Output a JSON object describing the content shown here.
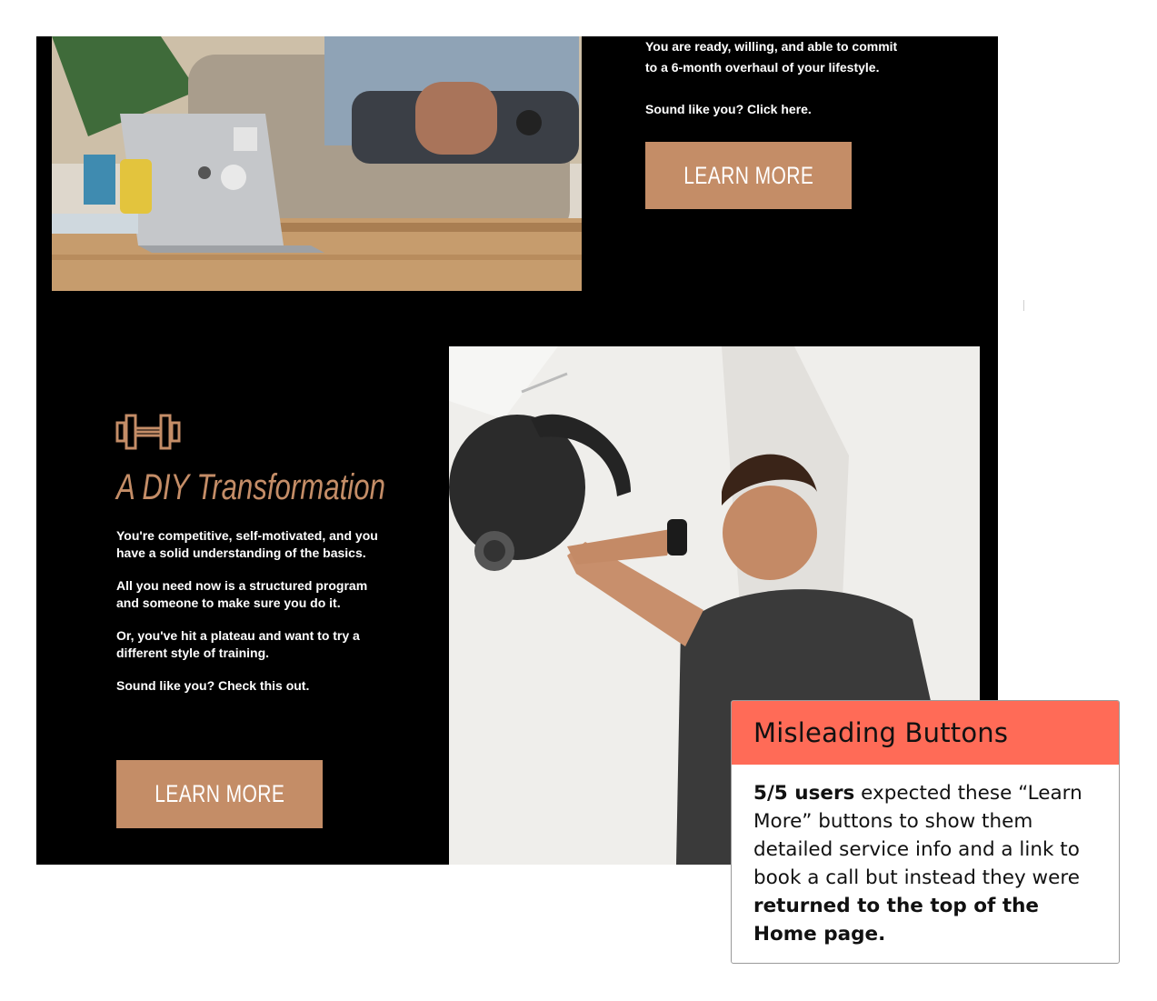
{
  "top_section": {
    "lines": [
      "You are ready, willing, and able to commit",
      "to a 6-month overhaul of your lifestyle."
    ],
    "prompt": "Sound like you? Click here.",
    "button_label": "LEARN MORE"
  },
  "diy_section": {
    "title": "A DIY Transformation",
    "paragraphs": [
      "You're competitive, self-motivated, and you have a solid understanding of the basics.",
      "All you need now is a structured program and someone to make sure you do it.",
      "Or, you've hit a plateau and want to try a different style of training.",
      "Sound like you? Check this out."
    ],
    "button_label": "LEARN MORE"
  },
  "callout": {
    "title": "Misleading Buttons",
    "bold_lead": "5/5 users",
    "text_middle": " expected these “Learn More” buttons to show them detailed service info and a link to book a call but instead they were ",
    "bold_end": "returned to the top of the Home page."
  },
  "colors": {
    "accent": "#c48d67",
    "callout_header": "#ff6b57",
    "panel_background": "#000000"
  },
  "icons": [
    "dumbbell-icon"
  ]
}
